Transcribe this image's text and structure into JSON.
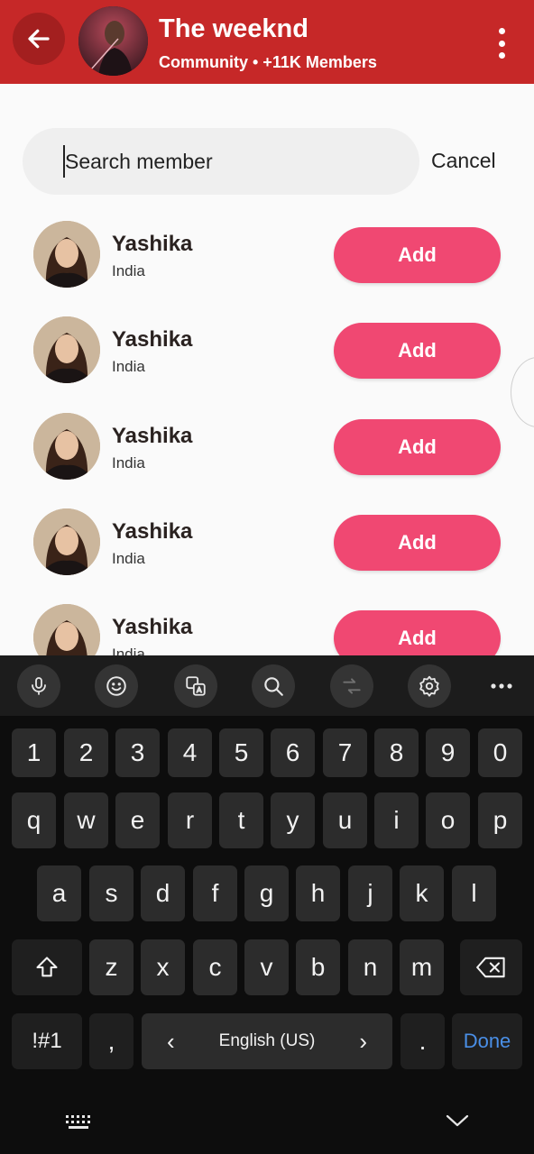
{
  "header": {
    "title": "The weeknd",
    "subtitle": "Community • +11K Members",
    "background_color": "#c62828",
    "back_icon": "arrow-left-icon",
    "menu_icon": "more-vertical-icon"
  },
  "search": {
    "placeholder": "Search member",
    "value": "",
    "cancel_label": "Cancel"
  },
  "members": [
    {
      "name": "Yashika",
      "country": "India",
      "action": "Add"
    },
    {
      "name": "Yashika",
      "country": "India",
      "action": "Add"
    },
    {
      "name": "Yashika",
      "country": "India",
      "action": "Add"
    },
    {
      "name": "Yashika",
      "country": "India",
      "action": "Add"
    },
    {
      "name": "Yashika",
      "country": "India",
      "action": "Add"
    }
  ],
  "accent_color": "#f04872",
  "keyboard": {
    "toolbar_icons": [
      "microphone-icon",
      "emoji-icon",
      "translate-icon",
      "search-icon",
      "swap-icon",
      "settings-icon",
      "more-horizontal-icon"
    ],
    "number_row": [
      "1",
      "2",
      "3",
      "4",
      "5",
      "6",
      "7",
      "8",
      "9",
      "0"
    ],
    "row1": [
      "q",
      "w",
      "e",
      "r",
      "t",
      "y",
      "u",
      "i",
      "o",
      "p"
    ],
    "row2": [
      "a",
      "s",
      "d",
      "f",
      "g",
      "h",
      "j",
      "k",
      "l"
    ],
    "row3": [
      "z",
      "x",
      "c",
      "v",
      "b",
      "n",
      "m"
    ],
    "symbols_label": "!#1",
    "comma": ",",
    "language": "English (US)",
    "lang_prev": "‹",
    "lang_next": "›",
    "period": ".",
    "done_label": "Done"
  },
  "nav_bar": {
    "keyboard_icon": "keyboard-icon",
    "hide_icon": "chevron-down-icon"
  }
}
